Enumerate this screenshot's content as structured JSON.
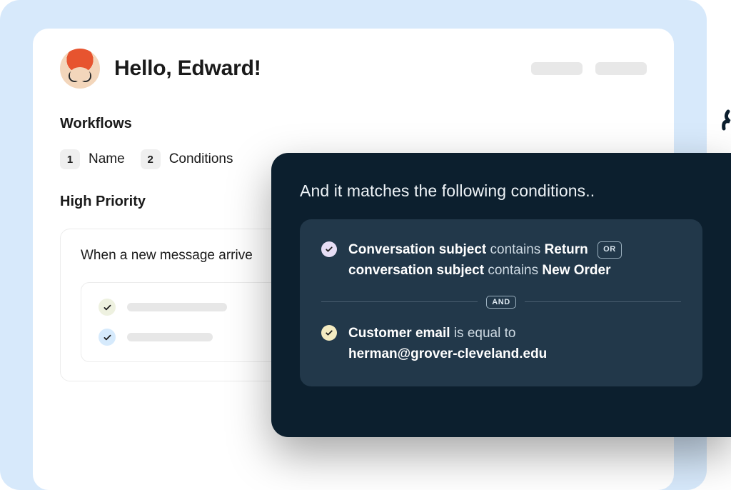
{
  "header": {
    "greeting": "Hello, Edward!"
  },
  "workflows": {
    "section_title": "Workflows",
    "steps": [
      {
        "num": "1",
        "label": "Name"
      },
      {
        "num": "2",
        "label": "Conditions"
      }
    ],
    "workflow_title": "High Priority",
    "panel_head": "When a new message arrive"
  },
  "overlay": {
    "title": "And it matches the following conditions..",
    "or_label": "OR",
    "and_label": "AND",
    "cond1_field_a": "Conversation subject",
    "cond1_op_a": "contains",
    "cond1_val_a": "Return",
    "cond1_field_b": "conversation subject",
    "cond1_op_b": "contains",
    "cond1_val_b": "New Order",
    "cond2_field": "Customer email",
    "cond2_op": "is equal to",
    "cond2_val": "herman@grover-cleveland.edu"
  }
}
